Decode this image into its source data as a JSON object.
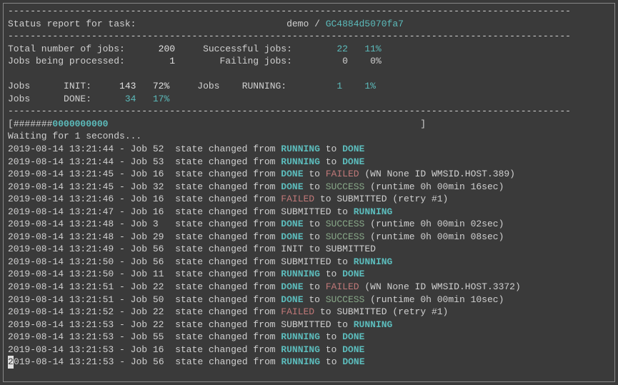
{
  "header": {
    "title": "Status report for task:",
    "task_name": "demo",
    "task_id": "GC4884d5070fa7"
  },
  "stats": {
    "total_label": "Total number of jobs:",
    "total_value": "200",
    "successful_label": "Successful jobs:",
    "successful_value": "22",
    "successful_pct": "11%",
    "processing_label": "Jobs being processed:",
    "processing_value": "1",
    "failing_label": "Failing jobs:",
    "failing_value": "0",
    "failing_pct": "0%",
    "init_label": "Jobs      INIT:",
    "init_value": "143",
    "init_pct": "72%",
    "running_label": "Jobs    RUNNING:",
    "running_value": "1",
    "running_pct": "1%",
    "done_label": "Jobs      DONE:",
    "done_value": "34",
    "done_pct": "17%"
  },
  "progress": {
    "hash": "#######",
    "zeros": "0000000000"
  },
  "waiting": "Waiting for 1 seconds...",
  "logs": [
    {
      "ts": "2019-08-14 13:21:44",
      "job": "52",
      "from": "RUNNING",
      "from_color": "cyan",
      "to": "DONE",
      "to_color": "cyan",
      "extra": ""
    },
    {
      "ts": "2019-08-14 13:21:44",
      "job": "53",
      "from": "RUNNING",
      "from_color": "cyan",
      "to": "DONE",
      "to_color": "cyan",
      "extra": ""
    },
    {
      "ts": "2019-08-14 13:21:45",
      "job": "16",
      "from": "DONE",
      "from_color": "cyan",
      "to": "FAILED",
      "to_color": "red",
      "extra": " (WN None ID WMSID.HOST.389)"
    },
    {
      "ts": "2019-08-14 13:21:45",
      "job": "32",
      "from": "DONE",
      "from_color": "cyan",
      "to": "SUCCESS",
      "to_color": "green",
      "extra": " (runtime 0h 00min 16sec)"
    },
    {
      "ts": "2019-08-14 13:21:46",
      "job": "16",
      "from": "FAILED",
      "from_color": "red",
      "to": "SUBMITTED",
      "to_color": "gray",
      "extra": " (retry #1)"
    },
    {
      "ts": "2019-08-14 13:21:47",
      "job": "16",
      "from": "SUBMITTED",
      "from_color": "gray",
      "to": "RUNNING",
      "to_color": "cyan",
      "extra": ""
    },
    {
      "ts": "2019-08-14 13:21:48",
      "job": "3",
      "from": "DONE",
      "from_color": "cyan",
      "to": "SUCCESS",
      "to_color": "green",
      "extra": " (runtime 0h 00min 02sec)"
    },
    {
      "ts": "2019-08-14 13:21:48",
      "job": "29",
      "from": "DONE",
      "from_color": "cyan",
      "to": "SUCCESS",
      "to_color": "green",
      "extra": " (runtime 0h 00min 08sec)"
    },
    {
      "ts": "2019-08-14 13:21:49",
      "job": "56",
      "from": "INIT",
      "from_color": "gray",
      "to": "SUBMITTED",
      "to_color": "gray",
      "extra": ""
    },
    {
      "ts": "2019-08-14 13:21:50",
      "job": "56",
      "from": "SUBMITTED",
      "from_color": "gray",
      "to": "RUNNING",
      "to_color": "cyan",
      "extra": ""
    },
    {
      "ts": "2019-08-14 13:21:50",
      "job": "11",
      "from": "RUNNING",
      "from_color": "cyan",
      "to": "DONE",
      "to_color": "cyan",
      "extra": ""
    },
    {
      "ts": "2019-08-14 13:21:51",
      "job": "22",
      "from": "DONE",
      "from_color": "cyan",
      "to": "FAILED",
      "to_color": "red",
      "extra": " (WN None ID WMSID.HOST.3372)"
    },
    {
      "ts": "2019-08-14 13:21:51",
      "job": "50",
      "from": "DONE",
      "from_color": "cyan",
      "to": "SUCCESS",
      "to_color": "green",
      "extra": " (runtime 0h 00min 10sec)"
    },
    {
      "ts": "2019-08-14 13:21:52",
      "job": "22",
      "from": "FAILED",
      "from_color": "red",
      "to": "SUBMITTED",
      "to_color": "gray",
      "extra": " (retry #1)"
    },
    {
      "ts": "2019-08-14 13:21:53",
      "job": "22",
      "from": "SUBMITTED",
      "from_color": "gray",
      "to": "RUNNING",
      "to_color": "cyan",
      "extra": ""
    },
    {
      "ts": "2019-08-14 13:21:53",
      "job": "55",
      "from": "RUNNING",
      "from_color": "cyan",
      "to": "DONE",
      "to_color": "cyan",
      "extra": ""
    },
    {
      "ts": "2019-08-14 13:21:53",
      "job": "16",
      "from": "RUNNING",
      "from_color": "cyan",
      "to": "DONE",
      "to_color": "cyan",
      "extra": ""
    },
    {
      "ts": "2019-08-14 13:21:53",
      "job": "56",
      "from": "RUNNING",
      "from_color": "cyan",
      "to": "DONE",
      "to_color": "cyan",
      "extra": ""
    }
  ]
}
